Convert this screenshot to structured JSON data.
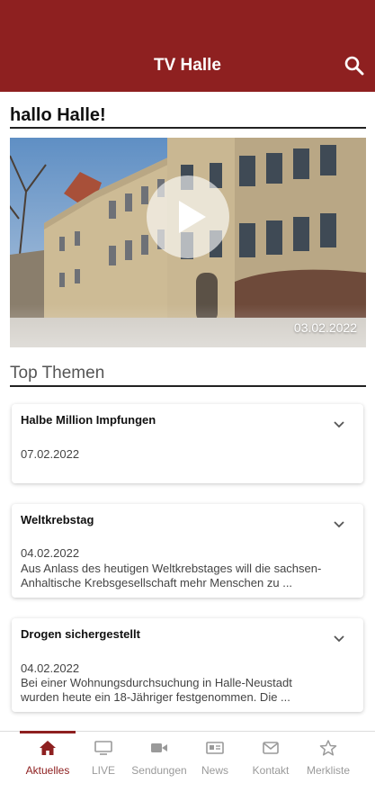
{
  "header": {
    "title": "TV Halle",
    "search_icon": "search-icon"
  },
  "greeting": "hallo Halle!",
  "featured_video": {
    "date": "03.02.2022",
    "play_icon": "play-icon"
  },
  "section_title": "Top Themen",
  "articles": [
    {
      "title": "Halbe Million Impfungen",
      "date": "07.02.2022",
      "teaser_line1": "",
      "teaser_line2": ""
    },
    {
      "title": "Weltkrebstag",
      "date": "04.02.2022",
      "teaser_line1": "Aus Anlass des heutigen Weltkrebstages will die sachsen-",
      "teaser_line2": "Anhaltische Krebsgesellschaft mehr Menschen zu ..."
    },
    {
      "title": "Drogen sichergestellt",
      "date": "04.02.2022",
      "teaser_line1": "Bei einer Wohnungsdurchsuchung in Halle-Neustadt",
      "teaser_line2": "wurden heute ein 18-Jähriger festgenommen. Die ..."
    }
  ],
  "tabs": [
    {
      "label": "Aktuelles",
      "icon": "home-icon",
      "active": true
    },
    {
      "label": "LIVE",
      "icon": "tv-icon",
      "active": false
    },
    {
      "label": "Sendungen",
      "icon": "video-camera-icon",
      "active": false
    },
    {
      "label": "News",
      "icon": "news-icon",
      "active": false
    },
    {
      "label": "Kontakt",
      "icon": "mail-icon",
      "active": false
    },
    {
      "label": "Merkliste",
      "icon": "star-icon",
      "active": false
    }
  ],
  "colors": {
    "brand": "#8e2020",
    "inactive_tab": "#9a9a9a",
    "background": "#ffffff"
  }
}
